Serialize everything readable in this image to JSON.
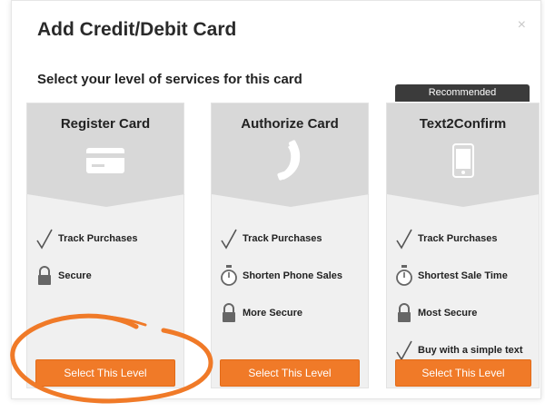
{
  "modal": {
    "title": "Add Credit/Debit Card",
    "close_icon": "×",
    "subtitle": "Select your level of services for this card",
    "recommended_badge": "Recommended"
  },
  "cards": [
    {
      "title": "Register Card",
      "icon": "credit-card-icon",
      "features": [
        {
          "icon": "checkmark-icon",
          "label": "Track Purchases"
        },
        {
          "icon": "lock-icon",
          "label": "Secure"
        }
      ],
      "button_label": "Select This Level"
    },
    {
      "title": "Authorize Card",
      "icon": "phone-handset-icon",
      "features": [
        {
          "icon": "checkmark-icon",
          "label": "Track Purchases"
        },
        {
          "icon": "stopwatch-icon",
          "label": "Shorten Phone Sales"
        },
        {
          "icon": "lock-icon",
          "label": "More Secure"
        }
      ],
      "button_label": "Select This Level"
    },
    {
      "title": "Text2Confirm",
      "icon": "smartphone-icon",
      "features": [
        {
          "icon": "checkmark-icon",
          "label": "Track Purchases"
        },
        {
          "icon": "stopwatch-icon",
          "label": "Shortest Sale Time"
        },
        {
          "icon": "lock-icon",
          "label": "Most Secure"
        },
        {
          "icon": "checkmark-icon",
          "label": "Buy with a simple text"
        }
      ],
      "button_label": "Select This Level"
    }
  ],
  "colors": {
    "accent": "#f07a28",
    "card_head": "#d8d8d8",
    "card_body": "#f0f0f0",
    "badge": "#3b3b3b",
    "annotation_circle": "#f07a28"
  }
}
